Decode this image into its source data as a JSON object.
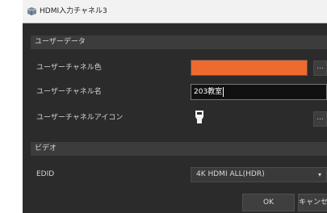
{
  "window": {
    "title": "HDMI入力チャネル3"
  },
  "sections": {
    "user_data": "ユーザーデータ",
    "video": "ビデオ"
  },
  "rows": {
    "channel_color_label": "ユーザーチャネル色",
    "channel_name_label": "ユーザーチャネル名",
    "channel_icon_label": "ユーザーチャネルアイコン",
    "edid_label": "EDID"
  },
  "fields": {
    "channel_color_value": "#ee6a2e",
    "channel_name_value": "203教室",
    "channel_icon": "hdmi-connector-icon",
    "edid_value": "4K HDMI ALL(HDR)"
  },
  "buttons": {
    "ellipsis": "...",
    "ok": "OK",
    "cancel": "キャンセル"
  },
  "colors": {
    "accent_orange": "#ee6a2e",
    "dialog_background": "#2b2b2b"
  }
}
